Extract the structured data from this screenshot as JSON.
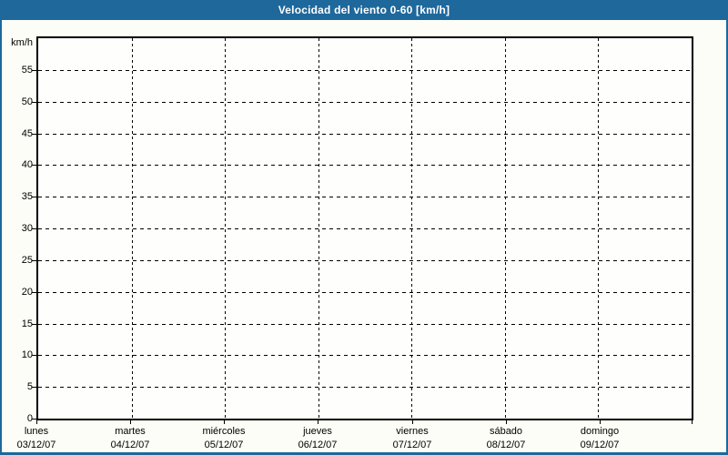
{
  "window": {
    "title": "Velocidad del viento 0-60 [km/h]"
  },
  "colors": {
    "accent": "#1e689c",
    "title_text": "#ffffff",
    "background": "#fcfdf6",
    "plot_background": "#fefefc",
    "axis": "#000000",
    "grid": "#000000",
    "text": "#000000"
  },
  "chart_data": {
    "type": "line",
    "title": "Velocidad del viento 0-60 [km/h]",
    "ylabel": "km/h",
    "xlabel": "",
    "ylim": [
      0,
      60
    ],
    "y_ticks": [
      0,
      5,
      10,
      15,
      20,
      25,
      30,
      35,
      40,
      45,
      50,
      55
    ],
    "x_intervals": 7,
    "x_categories": [
      {
        "day": "lunes",
        "date": "03/12/07"
      },
      {
        "day": "martes",
        "date": "04/12/07"
      },
      {
        "day": "miércoles",
        "date": "05/12/07"
      },
      {
        "day": "jueves",
        "date": "06/12/07"
      },
      {
        "day": "viernes",
        "date": "07/12/07"
      },
      {
        "day": "sábado",
        "date": "08/12/07"
      },
      {
        "day": "domingo",
        "date": "09/12/07"
      }
    ],
    "grid": true,
    "grid_style": "dashed",
    "legend": null,
    "series": []
  }
}
